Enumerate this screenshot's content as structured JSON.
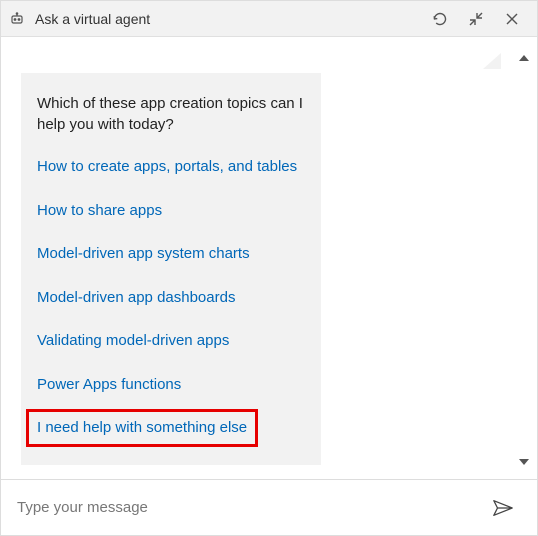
{
  "header": {
    "title": "Ask a virtual agent"
  },
  "card": {
    "prompt": "Which of these app creation topics can I help you with today?",
    "options": [
      "How to create apps, portals, and tables",
      "How to share apps",
      "Model-driven app system charts",
      "Model-driven app dashboards",
      "Validating model-driven apps",
      "Power Apps functions",
      "I need help with something else"
    ]
  },
  "input": {
    "placeholder": "Type your message"
  }
}
